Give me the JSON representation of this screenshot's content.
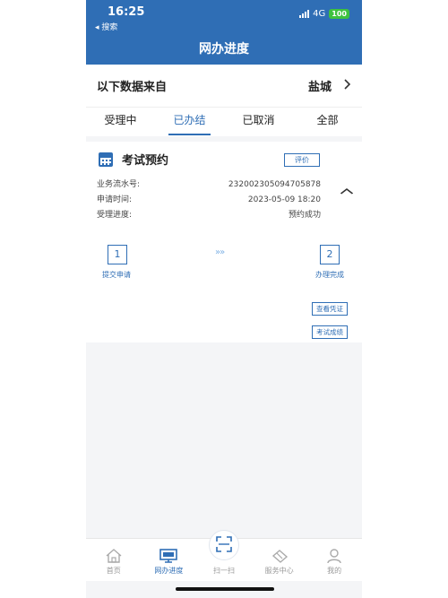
{
  "status": {
    "time": "16:25",
    "back": "◂ 搜索",
    "network": "4G",
    "battery": "100"
  },
  "header": {
    "title": "网办进度"
  },
  "source": {
    "label": "以下数据来自",
    "city": "盐城"
  },
  "tabs": [
    {
      "label": "受理中"
    },
    {
      "label": "已办结"
    },
    {
      "label": "已取消"
    },
    {
      "label": "全部"
    }
  ],
  "card": {
    "title": "考试预约",
    "rate_label": "评价",
    "rows": [
      {
        "label": "业务流水号:",
        "value": "232002305094705878"
      },
      {
        "label": "申请时间:",
        "value": "2023-05-09 18:20"
      },
      {
        "label": "受理进度:",
        "value": "预约成功"
      }
    ],
    "steps": [
      {
        "number": "1",
        "label": "提交申请"
      },
      {
        "number": "2",
        "label": "办理完成"
      }
    ],
    "arrows": "»»",
    "view_voucher": "查看凭证",
    "exam_score": "考试成绩"
  },
  "tabbar": [
    {
      "label": "首页",
      "icon": "home-icon"
    },
    {
      "label": "网办进度",
      "icon": "monitor-icon"
    },
    {
      "label": "扫一扫",
      "icon": "scan-icon"
    },
    {
      "label": "服务中心",
      "icon": "handshake-icon"
    },
    {
      "label": "我的",
      "icon": "user-icon"
    }
  ],
  "colors": {
    "primary": "#2f6eb5",
    "battery": "#3ec23e"
  }
}
